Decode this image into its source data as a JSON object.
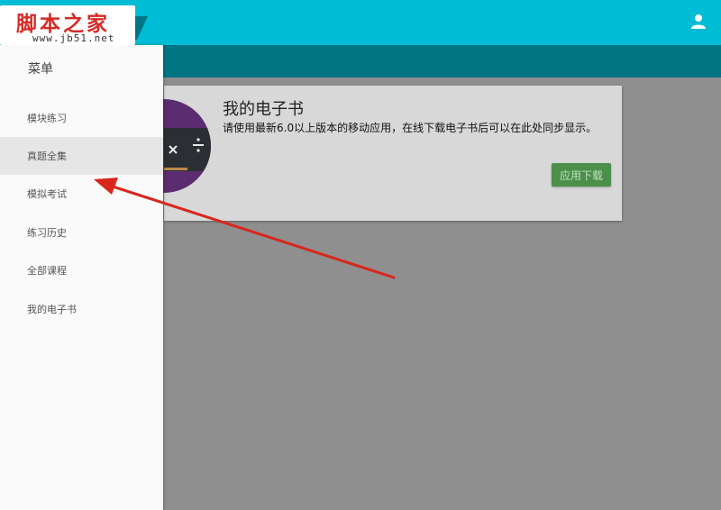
{
  "watermark": {
    "title": "脚本之家",
    "url": "www.jb51.net"
  },
  "header": {
    "user_icon": "person-icon"
  },
  "sidebar": {
    "title": "菜单",
    "items": [
      {
        "label": "模块练习"
      },
      {
        "label": "真题全集",
        "active": true
      },
      {
        "label": "模拟考试"
      },
      {
        "label": "练习历史"
      },
      {
        "label": "全部课程"
      },
      {
        "label": "我的电子书"
      }
    ]
  },
  "card": {
    "title": "我的电子书",
    "description": "请使用最新6.0以上版本的移动应用，在线下载电子书后可以在此处同步显示。",
    "button_label": "应用下载",
    "icon": "ebook-calculator-icon"
  },
  "colors": {
    "topbar": "#00bcd4",
    "subbar": "#007685",
    "overlay": "#8f8f8f",
    "button": "#4b8f4b",
    "arrow": "#d9261c"
  }
}
